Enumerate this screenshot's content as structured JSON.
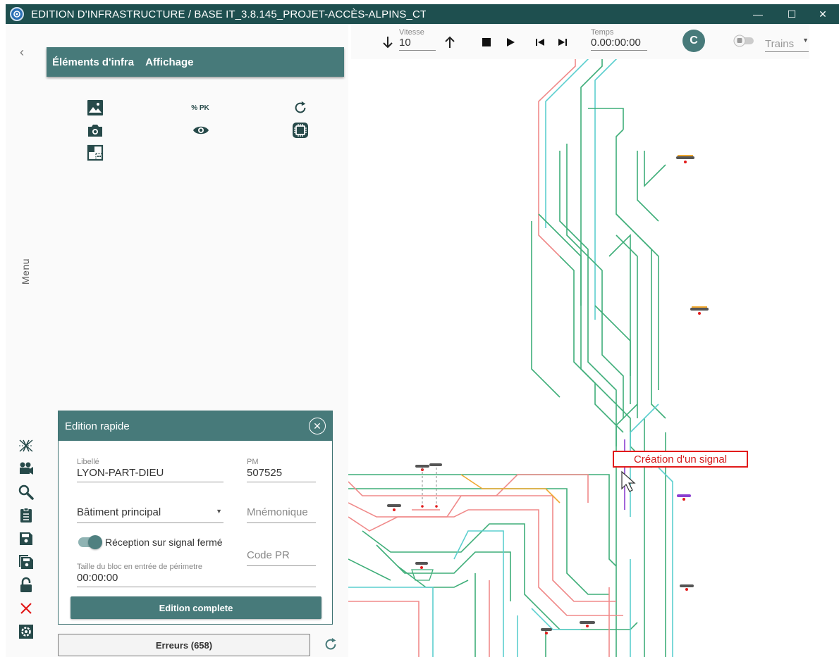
{
  "window": {
    "title": "EDITION D'INFRASTRUCTURE / BASE IT_3.8.145_PROJET-ACCÈS-ALPINS_CT",
    "minimize": "—",
    "maximize": "☐",
    "close": "✕"
  },
  "nav": {
    "collapse": "‹",
    "menu_label": "Menu"
  },
  "panel": {
    "tabs": [
      {
        "label": "Éléments d'infra"
      },
      {
        "label": "Affichage"
      }
    ],
    "tools": [
      {
        "name": "image-icon"
      },
      {
        "name": "percent-pk",
        "label": "% PK"
      },
      {
        "name": "refresh-icon"
      },
      {
        "name": "camera-icon"
      },
      {
        "name": "eye-icon"
      },
      {
        "name": "chip-icon"
      },
      {
        "name": "layout-icon"
      }
    ]
  },
  "quick_edit": {
    "title": "Edition rapide",
    "libelle_label": "Libellé",
    "libelle_value": "LYON-PART-DIEU",
    "pm_label": "PM",
    "pm_value": "507525",
    "building_value": "Bâtiment principal",
    "mnemonique_placeholder": "Mnémonique",
    "reception_label": "Réception sur signal fermé",
    "code_pr_placeholder": "Code PR",
    "taille_label": "Taille du bloc en entrée de périmetre",
    "taille_value": "00:00:00",
    "complete_button": "Edition complete"
  },
  "errors_button": "Erreurs (658)",
  "toolbar": {
    "vitesse_label": "Vitesse",
    "vitesse_value": "10",
    "temps_label": "Temps",
    "temps_value": "0.00:00:00",
    "avatar_letter": "C",
    "trains_label": "Trains"
  },
  "map": {
    "tooltip": "Création d'un signal"
  },
  "colors": {
    "titlebar": "#1e4f4f",
    "accent": "#477a7a",
    "track_green": "#3fae79",
    "track_red": "#f08a8a",
    "track_cyan": "#5ccfcf",
    "track_orange": "#f0a830",
    "tooltip_red": "#e21b1b"
  }
}
